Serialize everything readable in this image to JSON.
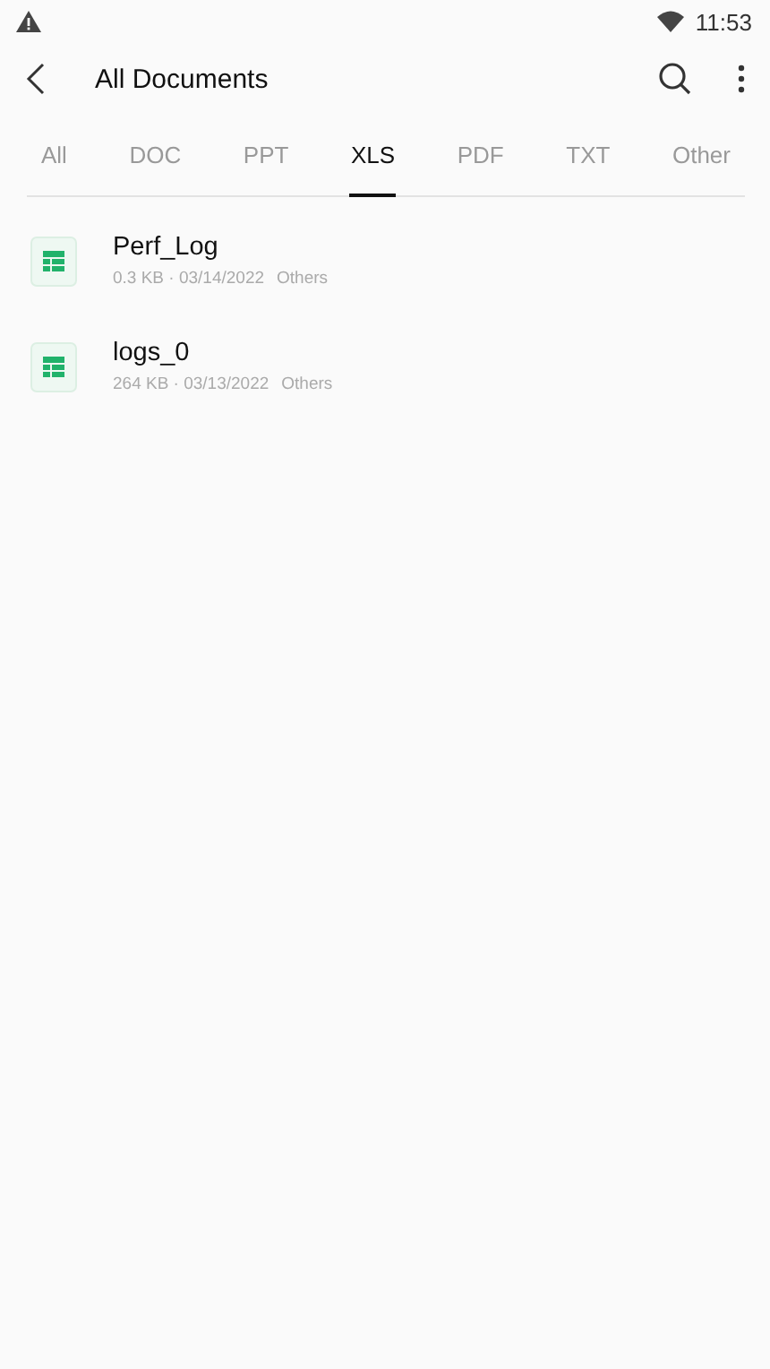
{
  "status_bar": {
    "time": "11:53"
  },
  "header": {
    "title": "All Documents"
  },
  "tabs": [
    {
      "label": "All",
      "selected": false
    },
    {
      "label": "DOC",
      "selected": false
    },
    {
      "label": "PPT",
      "selected": false
    },
    {
      "label": "XLS",
      "selected": true
    },
    {
      "label": "PDF",
      "selected": false
    },
    {
      "label": "TXT",
      "selected": false
    },
    {
      "label": "Other",
      "selected": false
    }
  ],
  "files": [
    {
      "name": "Perf_Log",
      "meta": "0.3 KB · 03/14/2022",
      "folder": "Others"
    },
    {
      "name": "logs_0",
      "meta": "264 KB · 03/13/2022",
      "folder": "Others"
    }
  ]
}
